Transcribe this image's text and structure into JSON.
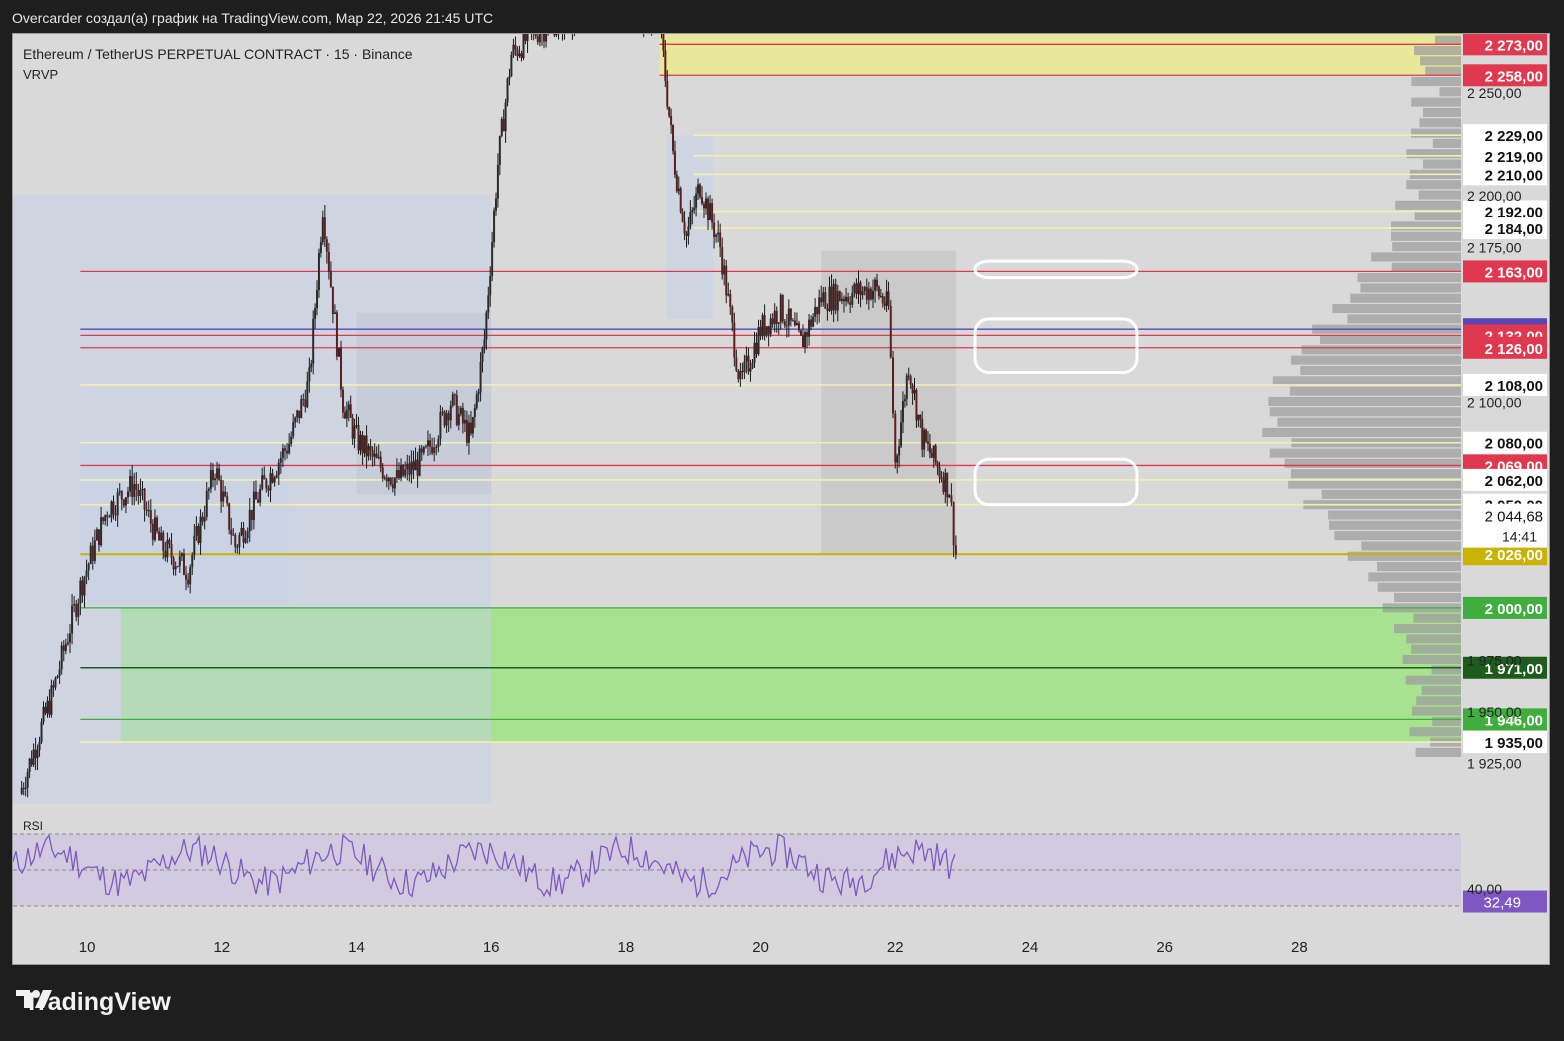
{
  "header": {
    "caption": "Overcarder создал(а) график на TradingView.com, Мар 22, 2026 21:45 UTC"
  },
  "chart": {
    "symbol": "Ethereum / TetherUS PERPETUAL CONTRACT · 15 · Binance",
    "indicator": "VRVP",
    "rsi_label": "RSI",
    "colors": {
      "background": "#d9d9d9",
      "candle": "#1a1a1a",
      "red_line": "#e0394f",
      "purple_line": "#5c45b8",
      "yellow_line": "#f3efb0",
      "gold_line": "#c9b200",
      "green_zone": "#a8e290",
      "green_line": "#3fae3f",
      "dark_green": "#1e5c1e",
      "rsi_line": "#7e57c2"
    }
  },
  "footer": {
    "brand": "TradingView",
    "logo_icon": "tradingview-logo-icon"
  },
  "chart_data": {
    "type": "candlestick",
    "title": "Ethereum / TetherUS PERPETUAL CONTRACT · 15 · Binance",
    "interval": "15",
    "x_axis": {
      "label": "",
      "tick_labels": [
        "10",
        "12",
        "14",
        "16",
        "18",
        "20",
        "22",
        "24",
        "26",
        "28"
      ],
      "range": [
        8.9,
        30.4
      ]
    },
    "y_axis": {
      "label": "",
      "range": [
        1905,
        2278
      ],
      "tick_labels": [
        "2 250,00",
        "2 200,00",
        "2 175,00",
        "2 100,00",
        "1 975,00",
        "1 950,00",
        "1 925,00"
      ],
      "tick_values": [
        2250,
        2200,
        2175,
        2100,
        1975,
        1950,
        1925
      ]
    },
    "price_path": [
      [
        9.0,
        1910
      ],
      [
        9.5,
        1960
      ],
      [
        9.9,
        2010
      ],
      [
        10.3,
        2048
      ],
      [
        10.7,
        2060
      ],
      [
        11.1,
        2030
      ],
      [
        11.5,
        2018
      ],
      [
        11.9,
        2068
      ],
      [
        12.2,
        2030
      ],
      [
        12.6,
        2058
      ],
      [
        13.0,
        2080
      ],
      [
        13.3,
        2110
      ],
      [
        13.5,
        2195
      ],
      [
        13.8,
        2100
      ],
      [
        14.0,
        2082
      ],
      [
        14.3,
        2070
      ],
      [
        14.6,
        2062
      ],
      [
        15.0,
        2072
      ],
      [
        15.4,
        2100
      ],
      [
        15.7,
        2082
      ],
      [
        15.9,
        2130
      ],
      [
        16.1,
        2215
      ],
      [
        16.3,
        2268
      ],
      [
        16.6,
        2278
      ],
      [
        17.0,
        2285
      ],
      [
        17.5,
        2290
      ],
      [
        18.0,
        2290
      ],
      [
        18.5,
        2285
      ],
      [
        18.7,
        2220
      ],
      [
        18.9,
        2180
      ],
      [
        19.1,
        2205
      ],
      [
        19.4,
        2175
      ],
      [
        19.7,
        2108
      ],
      [
        20.0,
        2135
      ],
      [
        20.3,
        2145
      ],
      [
        20.6,
        2128
      ],
      [
        20.9,
        2150
      ],
      [
        21.3,
        2152
      ],
      [
        21.7,
        2155
      ],
      [
        21.9,
        2145
      ],
      [
        22.0,
        2070
      ],
      [
        22.2,
        2118
      ],
      [
        22.4,
        2082
      ],
      [
        22.6,
        2070
      ],
      [
        22.8,
        2058
      ],
      [
        22.9,
        2026
      ]
    ],
    "price_levels": [
      {
        "value": 2273,
        "label": "2 273,00",
        "color": "#e0394f"
      },
      {
        "value": 2258,
        "label": "2 258,00",
        "color": "#e0394f"
      },
      {
        "value": 2229,
        "label": "2 229,00",
        "color": "#ffffff"
      },
      {
        "value": 2219,
        "label": "2 219,00",
        "color": "#ffffff"
      },
      {
        "value": 2210,
        "label": "2 210,00",
        "color": "#ffffff"
      },
      {
        "value": 2192,
        "label": "2 192,00",
        "color": "#ffffff"
      },
      {
        "value": 2184,
        "label": "2 184,00",
        "color": "#ffffff"
      },
      {
        "value": 2163,
        "label": "2 163,00",
        "color": "#e0394f"
      },
      {
        "value": 2135,
        "label": "2 135,00",
        "color": "#5c45b8"
      },
      {
        "value": 2132,
        "label": "2 132,00",
        "color": "#e0394f"
      },
      {
        "value": 2126,
        "label": "2 126,00",
        "color": "#e0394f"
      },
      {
        "value": 2108,
        "label": "2 108,00",
        "color": "#ffffff"
      },
      {
        "value": 2080,
        "label": "2 080,00",
        "color": "#ffffff"
      },
      {
        "value": 2069,
        "label": "2 069,00",
        "color": "#e0394f"
      },
      {
        "value": 2062,
        "label": "2 062,00",
        "color": "#ffffff"
      },
      {
        "value": 2050,
        "label": "2 050,00",
        "color": "#ffffff"
      },
      {
        "value": 2026,
        "label": "2 026,00",
        "color": "#c9b200"
      },
      {
        "value": 2000,
        "label": "2 000,00",
        "color": "#3fae3f"
      },
      {
        "value": 1971,
        "label": "1 971,00",
        "color": "#1e5c1e"
      },
      {
        "value": 1946,
        "label": "1 946,00",
        "color": "#3fae3f"
      },
      {
        "value": 1935,
        "label": "1 935,00",
        "color": "#ffffff"
      }
    ],
    "current_price": {
      "value": 2044.68,
      "label": "2 044,68",
      "countdown": "14:41"
    },
    "zones": [
      {
        "name": "resistance-zone",
        "x": [
          18.5,
          30.4
        ],
        "y": [
          2258,
          2278
        ],
        "color": "#e8e89a"
      },
      {
        "name": "demand-zone",
        "x": [
          10.5,
          30.4
        ],
        "y": [
          1935,
          2000
        ],
        "color": "#a8e290"
      },
      {
        "name": "range-box",
        "x": [
          14.0,
          16.0
        ],
        "y": [
          2055,
          2143
        ],
        "color": "#c8c8c8"
      },
      {
        "name": "range-box",
        "x": [
          20.9,
          22.9
        ],
        "y": [
          2026,
          2173
        ],
        "color": "#c8c8c8"
      }
    ],
    "rsi": {
      "current": 32.49,
      "current_label": "32,49",
      "tick_label": "40,00",
      "upper_band": 70,
      "lower_band": 30,
      "middle": 50
    },
    "grid": false,
    "legend": "none"
  }
}
